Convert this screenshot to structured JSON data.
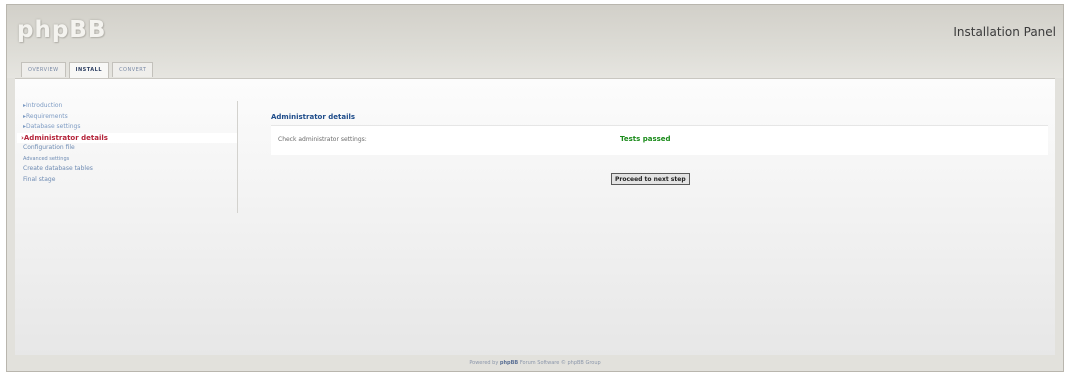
{
  "app": {
    "logo_text": "phpBB",
    "panel_title": "Installation Panel"
  },
  "tabs": [
    {
      "label": "OVERVIEW",
      "active": false
    },
    {
      "label": "INSTALL",
      "active": true
    },
    {
      "label": "CONVERT",
      "active": false
    }
  ],
  "sidebar": {
    "items": [
      {
        "label": "▸Introduction",
        "state": "done"
      },
      {
        "label": "▸Requirements",
        "state": "done"
      },
      {
        "label": "▸Database settings",
        "state": "done"
      },
      {
        "label": "›Administrator details",
        "state": "active"
      },
      {
        "label": "Configuration file",
        "state": "pending"
      },
      {
        "label": "Advanced settings",
        "state": "pending"
      },
      {
        "label": "Create database tables",
        "state": "pending"
      },
      {
        "label": "Final stage",
        "state": "pending"
      }
    ]
  },
  "main": {
    "section_title": "Administrator details",
    "check_label": "Check administrator settings:",
    "check_status": "Tests passed",
    "next_button": "Proceed to next step"
  },
  "footer": {
    "prefix": "Powered by ",
    "brand": "phpBB",
    "suffix": " Forum Software © phpBB Group"
  },
  "colors": {
    "accent": "#1e4c8a",
    "active_nav": "#b4243a",
    "success": "#1a8b1a"
  }
}
